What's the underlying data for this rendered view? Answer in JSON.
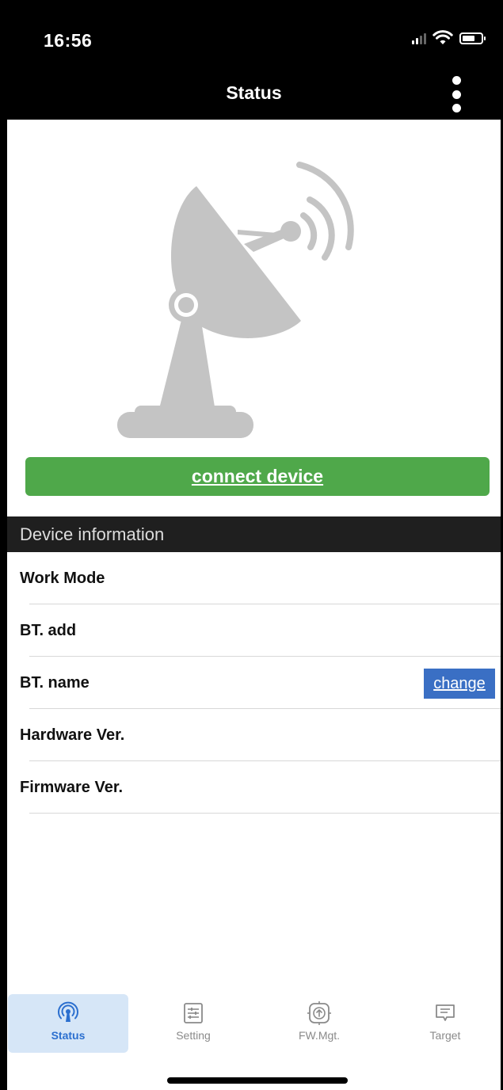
{
  "status_bar": {
    "time": "16:56"
  },
  "nav": {
    "title": "Status",
    "more_icon": "more-vertical-icon"
  },
  "illustration": {
    "icon": "satellite-dish-icon",
    "color": "#c4c4c4"
  },
  "connect_button": {
    "label": "connect device",
    "color": "#4fa84a"
  },
  "device_info": {
    "header": "Device information",
    "rows": [
      {
        "label": "Work Mode"
      },
      {
        "label": "BT. add"
      },
      {
        "label": "BT. name",
        "action": "change"
      },
      {
        "label": "Hardware Ver."
      },
      {
        "label": "Firmware Ver."
      }
    ]
  },
  "tabs": [
    {
      "label": "Status",
      "icon": "broadcast-icon",
      "active": true
    },
    {
      "label": "Setting",
      "icon": "sliders-icon",
      "active": false
    },
    {
      "label": "FW.Mgt.",
      "icon": "firmware-upload-icon",
      "active": false
    },
    {
      "label": "Target",
      "icon": "message-icon",
      "active": false
    }
  ],
  "colors": {
    "accent_blue": "#3a6fc4",
    "active_tab_bg": "#d6e6f7",
    "active_tab_text": "#2b6fcf"
  }
}
